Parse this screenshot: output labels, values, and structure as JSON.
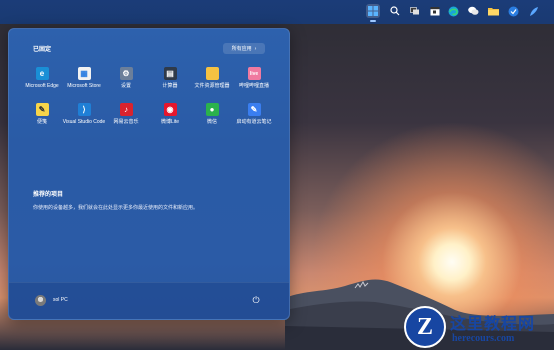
{
  "taskbar": {
    "icons": [
      "windows-start-icon",
      "search-icon",
      "task-view-icon",
      "calendar-icon",
      "edge-icon",
      "wechat-icon",
      "file-explorer-icon",
      "app-icon",
      "feather-icon"
    ]
  },
  "start_menu": {
    "pinned_title": "已固定",
    "all_apps_label": "所有应用",
    "all_apps_chevron": "›",
    "apps": [
      {
        "label": "Microsoft Edge",
        "icon": "edge-icon",
        "color": "#1a8fd6",
        "glyph": "e"
      },
      {
        "label": "Microsoft Store",
        "icon": "store-icon",
        "color": "#f2f2f2",
        "glyph": "▦"
      },
      {
        "label": "设置",
        "icon": "settings-gear-icon",
        "color": "#6c7f9a",
        "glyph": "⚙"
      },
      {
        "label": "计算器",
        "icon": "calculator-icon",
        "color": "#2f3a4a",
        "glyph": "▤"
      },
      {
        "label": "文件资源管理器",
        "icon": "folder-icon",
        "color": "#f5c242",
        "glyph": ""
      },
      {
        "label": "哔哩哔哩直播",
        "icon": "bilibili-live-icon",
        "color": "#f07aa0",
        "glyph": "live"
      },
      {
        "label": "便笺",
        "icon": "sticky-notes-icon",
        "color": "#f7d54a",
        "glyph": "✎"
      },
      {
        "label": "Visual Studio Code",
        "icon": "vscode-icon",
        "color": "#1f7fd6",
        "glyph": "⟩"
      },
      {
        "label": "网易云音乐",
        "icon": "netease-music-icon",
        "color": "#d9232e",
        "glyph": "♪"
      },
      {
        "label": "微博Lite",
        "icon": "weibo-icon",
        "color": "#e6162d",
        "glyph": "◉"
      },
      {
        "label": "微信",
        "icon": "wechat-icon",
        "color": "#2bb24c",
        "glyph": "●"
      },
      {
        "label": "启动有道云笔记",
        "icon": "youdao-note-icon",
        "color": "#3a7ef0",
        "glyph": "✎"
      }
    ],
    "recommended_title": "推荐的项目",
    "recommended_text": "你使用的设备越多，我们就会在此处显示更多你最近使用的文件和新应用。",
    "user_name": "sol PC",
    "power_glyph": "⏻"
  },
  "watermark": {
    "logo_letter": "Z",
    "title": "这里教程网",
    "subtitle": "herecours.com"
  }
}
